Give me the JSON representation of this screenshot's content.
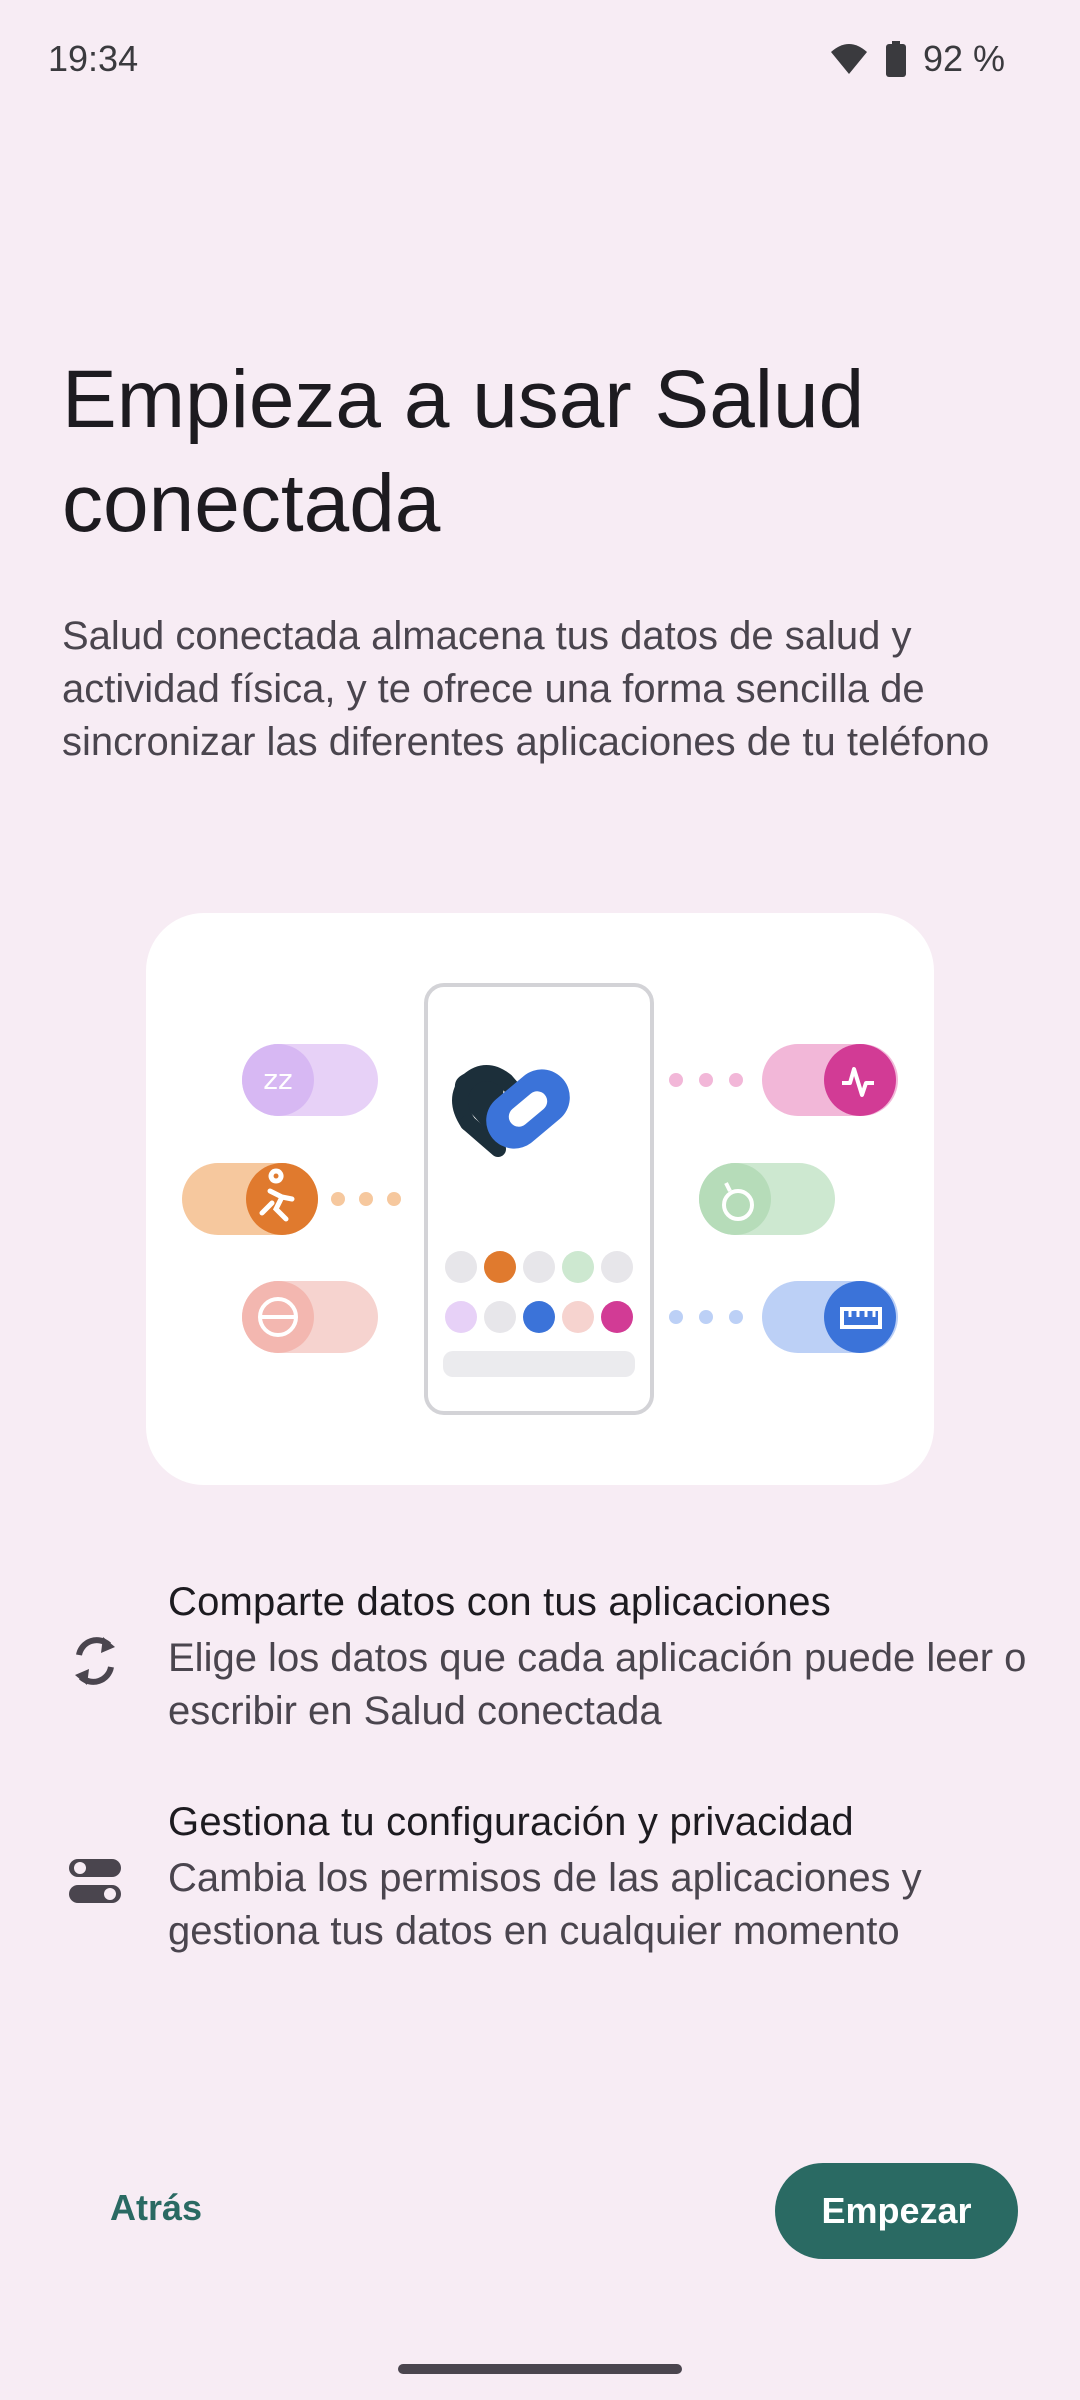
{
  "status_bar": {
    "time": "19:34",
    "battery_percent": "92 %",
    "icons": [
      "wifi-icon",
      "battery-icon"
    ]
  },
  "header": {
    "title": "Empieza a usar Salud conectada",
    "subtitle": "Salud conectada almacena tus datos de salud y actividad física, y te ofrece una forma sencilla de sincronizar las diferentes aplicaciones de tu teléfono"
  },
  "illustration": {
    "center_icon": "health-connect-logo",
    "left_toggles": [
      "sleep-icon",
      "running-icon",
      "nutrition-icon"
    ],
    "right_toggles": [
      "heart-rate-icon",
      "weight-icon",
      "measurement-icon"
    ]
  },
  "features": [
    {
      "icon": "sync-icon",
      "title": "Comparte datos con tus aplicaciones",
      "description": "Elige los datos que cada aplicación puede leer o escribir en Salud conectada"
    },
    {
      "icon": "settings-toggle-icon",
      "title": "Gestiona tu configuración y privacidad",
      "description": "Cambia los permisos de las aplicaciones y gestiona tus datos en cualquier momento"
    }
  ],
  "footer": {
    "back_label": "Atrás",
    "start_label": "Empezar"
  },
  "colors": {
    "background": "#f7ecf4",
    "accent": "#2a6a63",
    "logo_blue": "#3b73d9",
    "logo_dark": "#1c2f3a"
  }
}
